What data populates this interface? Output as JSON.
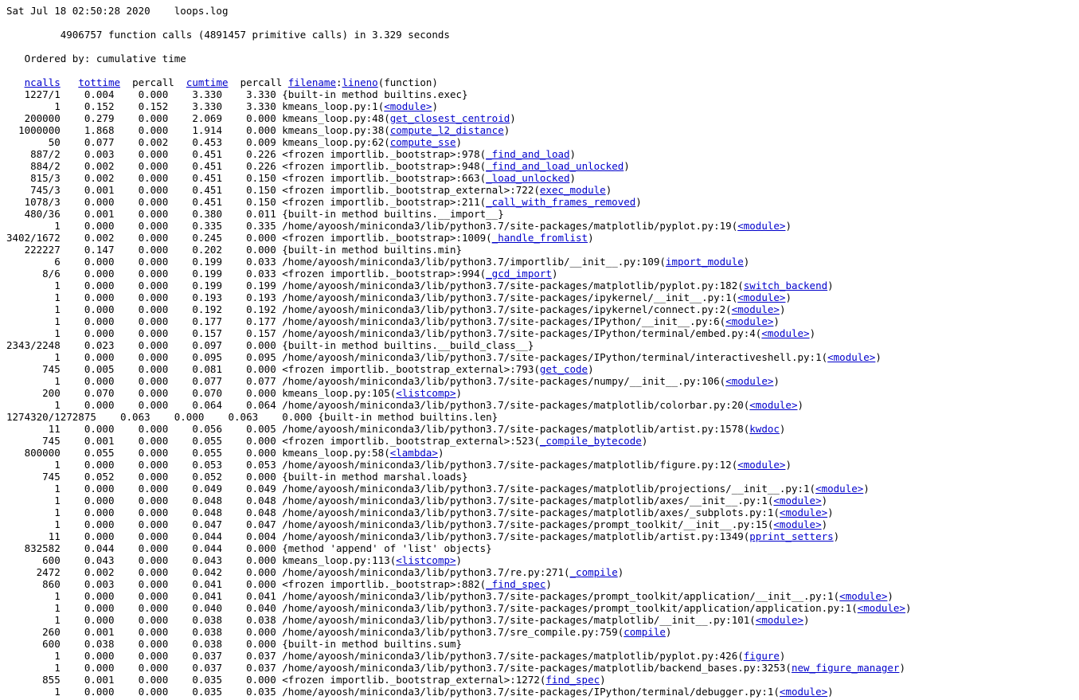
{
  "header": {
    "date": "Sat Jul 18 02:50:28 2020",
    "filename": "loops.log"
  },
  "summary": "4906757 function calls (4891457 primitive calls) in 3.329 seconds",
  "ordered_by": "Ordered by: cumulative time",
  "columns": {
    "ncalls": "ncalls",
    "tottime": "tottime",
    "percall1": "percall",
    "cumtime": "cumtime",
    "percall2": "percall",
    "filename": "filename",
    "lineno": "lineno",
    "function": "(function)"
  },
  "rows": [
    {
      "ncalls": "1227/1",
      "tottime": "0.004",
      "percall1": "0.000",
      "cumtime": "3.330",
      "percall2": "3.330",
      "prefix": "{built-in method builtins.exec}",
      "link": "",
      "suffix": ""
    },
    {
      "ncalls": "1",
      "tottime": "0.152",
      "percall1": "0.152",
      "cumtime": "3.330",
      "percall2": "3.330",
      "prefix": "kmeans_loop.py:1(",
      "link": "<module>",
      "suffix": ")"
    },
    {
      "ncalls": "200000",
      "tottime": "0.279",
      "percall1": "0.000",
      "cumtime": "2.069",
      "percall2": "0.000",
      "prefix": "kmeans_loop.py:48(",
      "link": "get_closest_centroid",
      "suffix": ")"
    },
    {
      "ncalls": "1000000",
      "tottime": "1.868",
      "percall1": "0.000",
      "cumtime": "1.914",
      "percall2": "0.000",
      "prefix": "kmeans_loop.py:38(",
      "link": "compute_l2_distance",
      "suffix": ")"
    },
    {
      "ncalls": "50",
      "tottime": "0.077",
      "percall1": "0.002",
      "cumtime": "0.453",
      "percall2": "0.009",
      "prefix": "kmeans_loop.py:62(",
      "link": "compute_sse",
      "suffix": ")"
    },
    {
      "ncalls": "887/2",
      "tottime": "0.003",
      "percall1": "0.000",
      "cumtime": "0.451",
      "percall2": "0.226",
      "prefix": "<frozen importlib._bootstrap>:978(",
      "link": "_find_and_load",
      "suffix": ")"
    },
    {
      "ncalls": "884/2",
      "tottime": "0.002",
      "percall1": "0.000",
      "cumtime": "0.451",
      "percall2": "0.226",
      "prefix": "<frozen importlib._bootstrap>:948(",
      "link": "_find_and_load_unlocked",
      "suffix": ")"
    },
    {
      "ncalls": "815/3",
      "tottime": "0.002",
      "percall1": "0.000",
      "cumtime": "0.451",
      "percall2": "0.150",
      "prefix": "<frozen importlib._bootstrap>:663(",
      "link": "_load_unlocked",
      "suffix": ")"
    },
    {
      "ncalls": "745/3",
      "tottime": "0.001",
      "percall1": "0.000",
      "cumtime": "0.451",
      "percall2": "0.150",
      "prefix": "<frozen importlib._bootstrap_external>:722(",
      "link": "exec_module",
      "suffix": ")"
    },
    {
      "ncalls": "1078/3",
      "tottime": "0.000",
      "percall1": "0.000",
      "cumtime": "0.451",
      "percall2": "0.150",
      "prefix": "<frozen importlib._bootstrap>:211(",
      "link": "_call_with_frames_removed",
      "suffix": ")"
    },
    {
      "ncalls": "480/36",
      "tottime": "0.001",
      "percall1": "0.000",
      "cumtime": "0.380",
      "percall2": "0.011",
      "prefix": "{built-in method builtins.__import__}",
      "link": "",
      "suffix": ""
    },
    {
      "ncalls": "1",
      "tottime": "0.000",
      "percall1": "0.000",
      "cumtime": "0.335",
      "percall2": "0.335",
      "prefix": "/home/ayoosh/miniconda3/lib/python3.7/site-packages/matplotlib/pyplot.py:19(",
      "link": "<module>",
      "suffix": ")"
    },
    {
      "ncalls": "3402/1672",
      "tottime": "0.002",
      "percall1": "0.000",
      "cumtime": "0.245",
      "percall2": "0.000",
      "prefix": "<frozen importlib._bootstrap>:1009(",
      "link": "_handle_fromlist",
      "suffix": ")"
    },
    {
      "ncalls": "222227",
      "tottime": "0.147",
      "percall1": "0.000",
      "cumtime": "0.202",
      "percall2": "0.000",
      "prefix": "{built-in method builtins.min}",
      "link": "",
      "suffix": ""
    },
    {
      "ncalls": "6",
      "tottime": "0.000",
      "percall1": "0.000",
      "cumtime": "0.199",
      "percall2": "0.033",
      "prefix": "/home/ayoosh/miniconda3/lib/python3.7/importlib/__init__.py:109(",
      "link": "import_module",
      "suffix": ")"
    },
    {
      "ncalls": "8/6",
      "tottime": "0.000",
      "percall1": "0.000",
      "cumtime": "0.199",
      "percall2": "0.033",
      "prefix": "<frozen importlib._bootstrap>:994(",
      "link": "_gcd_import",
      "suffix": ")"
    },
    {
      "ncalls": "1",
      "tottime": "0.000",
      "percall1": "0.000",
      "cumtime": "0.199",
      "percall2": "0.199",
      "prefix": "/home/ayoosh/miniconda3/lib/python3.7/site-packages/matplotlib/pyplot.py:182(",
      "link": "switch_backend",
      "suffix": ")"
    },
    {
      "ncalls": "1",
      "tottime": "0.000",
      "percall1": "0.000",
      "cumtime": "0.193",
      "percall2": "0.193",
      "prefix": "/home/ayoosh/miniconda3/lib/python3.7/site-packages/ipykernel/__init__.py:1(",
      "link": "<module>",
      "suffix": ")"
    },
    {
      "ncalls": "1",
      "tottime": "0.000",
      "percall1": "0.000",
      "cumtime": "0.192",
      "percall2": "0.192",
      "prefix": "/home/ayoosh/miniconda3/lib/python3.7/site-packages/ipykernel/connect.py:2(",
      "link": "<module>",
      "suffix": ")"
    },
    {
      "ncalls": "1",
      "tottime": "0.000",
      "percall1": "0.000",
      "cumtime": "0.177",
      "percall2": "0.177",
      "prefix": "/home/ayoosh/miniconda3/lib/python3.7/site-packages/IPython/__init__.py:6(",
      "link": "<module>",
      "suffix": ")"
    },
    {
      "ncalls": "1",
      "tottime": "0.000",
      "percall1": "0.000",
      "cumtime": "0.157",
      "percall2": "0.157",
      "prefix": "/home/ayoosh/miniconda3/lib/python3.7/site-packages/IPython/terminal/embed.py:4(",
      "link": "<module>",
      "suffix": ")"
    },
    {
      "ncalls": "2343/2248",
      "tottime": "0.023",
      "percall1": "0.000",
      "cumtime": "0.097",
      "percall2": "0.000",
      "prefix": "{built-in method builtins.__build_class__}",
      "link": "",
      "suffix": ""
    },
    {
      "ncalls": "1",
      "tottime": "0.000",
      "percall1": "0.000",
      "cumtime": "0.095",
      "percall2": "0.095",
      "prefix": "/home/ayoosh/miniconda3/lib/python3.7/site-packages/IPython/terminal/interactiveshell.py:1(",
      "link": "<module>",
      "suffix": ")"
    },
    {
      "ncalls": "745",
      "tottime": "0.005",
      "percall1": "0.000",
      "cumtime": "0.081",
      "percall2": "0.000",
      "prefix": "<frozen importlib._bootstrap_external>:793(",
      "link": "get_code",
      "suffix": ")"
    },
    {
      "ncalls": "1",
      "tottime": "0.000",
      "percall1": "0.000",
      "cumtime": "0.077",
      "percall2": "0.077",
      "prefix": "/home/ayoosh/miniconda3/lib/python3.7/site-packages/numpy/__init__.py:106(",
      "link": "<module>",
      "suffix": ")"
    },
    {
      "ncalls": "200",
      "tottime": "0.070",
      "percall1": "0.000",
      "cumtime": "0.070",
      "percall2": "0.000",
      "prefix": "kmeans_loop.py:105(",
      "link": "<listcomp>",
      "suffix": ")"
    },
    {
      "ncalls": "1",
      "tottime": "0.000",
      "percall1": "0.000",
      "cumtime": "0.064",
      "percall2": "0.064",
      "prefix": "/home/ayoosh/miniconda3/lib/python3.7/site-packages/matplotlib/colorbar.py:20(",
      "link": "<module>",
      "suffix": ")"
    },
    {
      "ncalls": "1274320/1272875",
      "tottime": "0.063",
      "percall1": "0.000",
      "cumtime": "0.063",
      "percall2": "0.000",
      "prefix": "{built-in method builtins.len}",
      "link": "",
      "suffix": "",
      "wide": true
    },
    {
      "ncalls": "11",
      "tottime": "0.000",
      "percall1": "0.000",
      "cumtime": "0.056",
      "percall2": "0.005",
      "prefix": "/home/ayoosh/miniconda3/lib/python3.7/site-packages/matplotlib/artist.py:1578(",
      "link": "kwdoc",
      "suffix": ")"
    },
    {
      "ncalls": "745",
      "tottime": "0.001",
      "percall1": "0.000",
      "cumtime": "0.055",
      "percall2": "0.000",
      "prefix": "<frozen importlib._bootstrap_external>:523(",
      "link": "_compile_bytecode",
      "suffix": ")"
    },
    {
      "ncalls": "800000",
      "tottime": "0.055",
      "percall1": "0.000",
      "cumtime": "0.055",
      "percall2": "0.000",
      "prefix": "kmeans_loop.py:58(",
      "link": "<lambda>",
      "suffix": ")"
    },
    {
      "ncalls": "1",
      "tottime": "0.000",
      "percall1": "0.000",
      "cumtime": "0.053",
      "percall2": "0.053",
      "prefix": "/home/ayoosh/miniconda3/lib/python3.7/site-packages/matplotlib/figure.py:12(",
      "link": "<module>",
      "suffix": ")"
    },
    {
      "ncalls": "745",
      "tottime": "0.052",
      "percall1": "0.000",
      "cumtime": "0.052",
      "percall2": "0.000",
      "prefix": "{built-in method marshal.loads}",
      "link": "",
      "suffix": ""
    },
    {
      "ncalls": "1",
      "tottime": "0.000",
      "percall1": "0.000",
      "cumtime": "0.049",
      "percall2": "0.049",
      "prefix": "/home/ayoosh/miniconda3/lib/python3.7/site-packages/matplotlib/projections/__init__.py:1(",
      "link": "<module>",
      "suffix": ")"
    },
    {
      "ncalls": "1",
      "tottime": "0.000",
      "percall1": "0.000",
      "cumtime": "0.048",
      "percall2": "0.048",
      "prefix": "/home/ayoosh/miniconda3/lib/python3.7/site-packages/matplotlib/axes/__init__.py:1(",
      "link": "<module>",
      "suffix": ")"
    },
    {
      "ncalls": "1",
      "tottime": "0.000",
      "percall1": "0.000",
      "cumtime": "0.048",
      "percall2": "0.048",
      "prefix": "/home/ayoosh/miniconda3/lib/python3.7/site-packages/matplotlib/axes/_subplots.py:1(",
      "link": "<module>",
      "suffix": ")"
    },
    {
      "ncalls": "1",
      "tottime": "0.000",
      "percall1": "0.000",
      "cumtime": "0.047",
      "percall2": "0.047",
      "prefix": "/home/ayoosh/miniconda3/lib/python3.7/site-packages/prompt_toolkit/__init__.py:15(",
      "link": "<module>",
      "suffix": ")"
    },
    {
      "ncalls": "11",
      "tottime": "0.000",
      "percall1": "0.000",
      "cumtime": "0.044",
      "percall2": "0.004",
      "prefix": "/home/ayoosh/miniconda3/lib/python3.7/site-packages/matplotlib/artist.py:1349(",
      "link": "pprint_setters",
      "suffix": ")"
    },
    {
      "ncalls": "832582",
      "tottime": "0.044",
      "percall1": "0.000",
      "cumtime": "0.044",
      "percall2": "0.000",
      "prefix": "{method 'append' of 'list' objects}",
      "link": "",
      "suffix": ""
    },
    {
      "ncalls": "600",
      "tottime": "0.043",
      "percall1": "0.000",
      "cumtime": "0.043",
      "percall2": "0.000",
      "prefix": "kmeans_loop.py:113(",
      "link": "<listcomp>",
      "suffix": ")"
    },
    {
      "ncalls": "2472",
      "tottime": "0.002",
      "percall1": "0.000",
      "cumtime": "0.042",
      "percall2": "0.000",
      "prefix": "/home/ayoosh/miniconda3/lib/python3.7/re.py:271(",
      "link": "_compile",
      "suffix": ")"
    },
    {
      "ncalls": "860",
      "tottime": "0.003",
      "percall1": "0.000",
      "cumtime": "0.041",
      "percall2": "0.000",
      "prefix": "<frozen importlib._bootstrap>:882(",
      "link": "_find_spec",
      "suffix": ")"
    },
    {
      "ncalls": "1",
      "tottime": "0.000",
      "percall1": "0.000",
      "cumtime": "0.041",
      "percall2": "0.041",
      "prefix": "/home/ayoosh/miniconda3/lib/python3.7/site-packages/prompt_toolkit/application/__init__.py:1(",
      "link": "<module>",
      "suffix": ")"
    },
    {
      "ncalls": "1",
      "tottime": "0.000",
      "percall1": "0.000",
      "cumtime": "0.040",
      "percall2": "0.040",
      "prefix": "/home/ayoosh/miniconda3/lib/python3.7/site-packages/prompt_toolkit/application/application.py:1(",
      "link": "<module>",
      "suffix": ")"
    },
    {
      "ncalls": "1",
      "tottime": "0.000",
      "percall1": "0.000",
      "cumtime": "0.038",
      "percall2": "0.038",
      "prefix": "/home/ayoosh/miniconda3/lib/python3.7/site-packages/matplotlib/__init__.py:101(",
      "link": "<module>",
      "suffix": ")"
    },
    {
      "ncalls": "260",
      "tottime": "0.001",
      "percall1": "0.000",
      "cumtime": "0.038",
      "percall2": "0.000",
      "prefix": "/home/ayoosh/miniconda3/lib/python3.7/sre_compile.py:759(",
      "link": "compile",
      "suffix": ")"
    },
    {
      "ncalls": "600",
      "tottime": "0.038",
      "percall1": "0.000",
      "cumtime": "0.038",
      "percall2": "0.000",
      "prefix": "{built-in method builtins.sum}",
      "link": "",
      "suffix": ""
    },
    {
      "ncalls": "1",
      "tottime": "0.000",
      "percall1": "0.000",
      "cumtime": "0.037",
      "percall2": "0.037",
      "prefix": "/home/ayoosh/miniconda3/lib/python3.7/site-packages/matplotlib/pyplot.py:426(",
      "link": "figure",
      "suffix": ")"
    },
    {
      "ncalls": "1",
      "tottime": "0.000",
      "percall1": "0.000",
      "cumtime": "0.037",
      "percall2": "0.037",
      "prefix": "/home/ayoosh/miniconda3/lib/python3.7/site-packages/matplotlib/backend_bases.py:3253(",
      "link": "new_figure_manager",
      "suffix": ")"
    },
    {
      "ncalls": "855",
      "tottime": "0.001",
      "percall1": "0.000",
      "cumtime": "0.035",
      "percall2": "0.000",
      "prefix": "<frozen importlib._bootstrap_external>:1272(",
      "link": "find_spec",
      "suffix": ")"
    },
    {
      "ncalls": "1",
      "tottime": "0.000",
      "percall1": "0.000",
      "cumtime": "0.035",
      "percall2": "0.035",
      "prefix": "/home/ayoosh/miniconda3/lib/python3.7/site-packages/IPython/terminal/debugger.py:1(",
      "link": "<module>",
      "suffix": ")"
    }
  ]
}
